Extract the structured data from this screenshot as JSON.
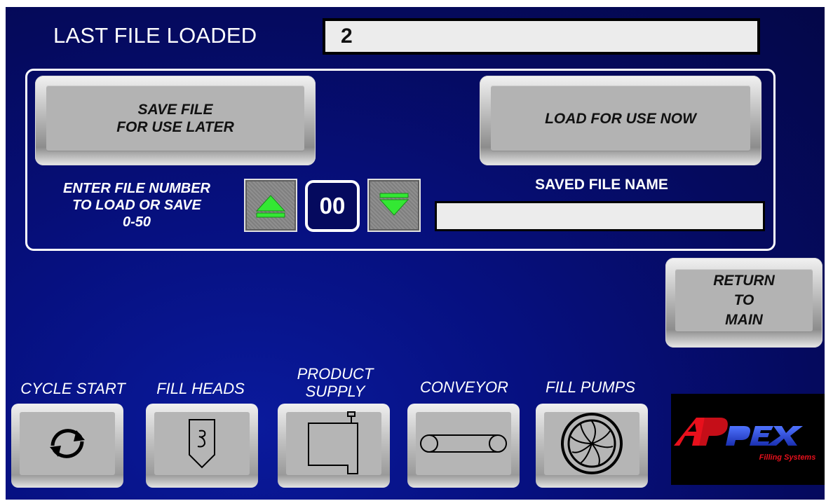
{
  "header": {
    "last_file_label": "LAST FILE LOADED",
    "last_file_value": "2"
  },
  "file_panel": {
    "save_button_line1": "SAVE FILE",
    "save_button_line2": "FOR USE LATER",
    "load_button_label": "LOAD FOR USE NOW",
    "enter_line1": "ENTER FILE NUMBER",
    "enter_line2": "TO LOAD OR SAVE",
    "enter_line3": "0-50",
    "file_number": "00",
    "saved_file_name_label": "SAVED FILE NAME",
    "saved_file_name_value": ""
  },
  "return_button": {
    "line1": "RETURN",
    "line2": "TO",
    "line3": "MAIN"
  },
  "nav": {
    "items": [
      {
        "label": "CYCLE START",
        "icon": "cycle-icon"
      },
      {
        "label": "FILL HEADS",
        "icon": "fill-head-icon"
      },
      {
        "label_line1": "PRODUCT",
        "label_line2": "SUPPLY",
        "icon": "tank-icon"
      },
      {
        "label": "CONVEYOR",
        "icon": "conveyor-icon"
      },
      {
        "label": "FILL PUMPS",
        "icon": "pump-icon"
      }
    ]
  },
  "logo": {
    "brand": "Apex",
    "tagline": "Filling Systems",
    "brand_color": "#e8101c",
    "accent_color": "#1c3fd6"
  },
  "colors": {
    "background": "#050a5e",
    "arrow_green": "#33e833"
  }
}
